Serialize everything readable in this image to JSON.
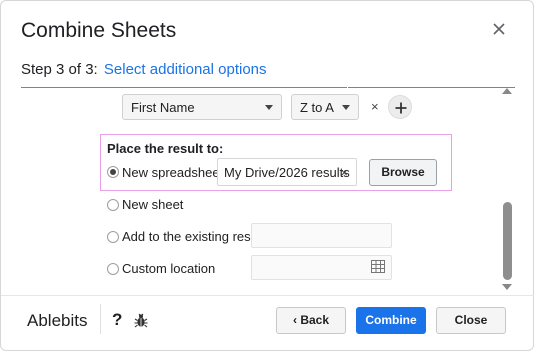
{
  "dialog": {
    "title": "Combine Sheets",
    "step_prefix": "Step 3 of 3:",
    "step_title": "Select additional options"
  },
  "sort_row": {
    "column_value": "First Name",
    "order_value": "Z to A",
    "remove_symbol": "×"
  },
  "result": {
    "heading": "Place the result to:",
    "options": {
      "new_spreadsheet": "New spreadsheet",
      "new_sheet": "New sheet",
      "existing_result": "Add to the existing result",
      "custom_location": "Custom location"
    },
    "spreadsheet_path": "My Drive/2026 results",
    "clear_symbol": "×",
    "browse_label": "Browse",
    "selected": "new_spreadsheet"
  },
  "footer": {
    "brand": "Ablebits",
    "help": "?",
    "back_label": "Back",
    "back_prefix": "‹",
    "combine_label": "Combine",
    "close_label": "Close"
  },
  "colors": {
    "accent": "#1a73e8",
    "highlight_border": "#e8a0e8"
  }
}
